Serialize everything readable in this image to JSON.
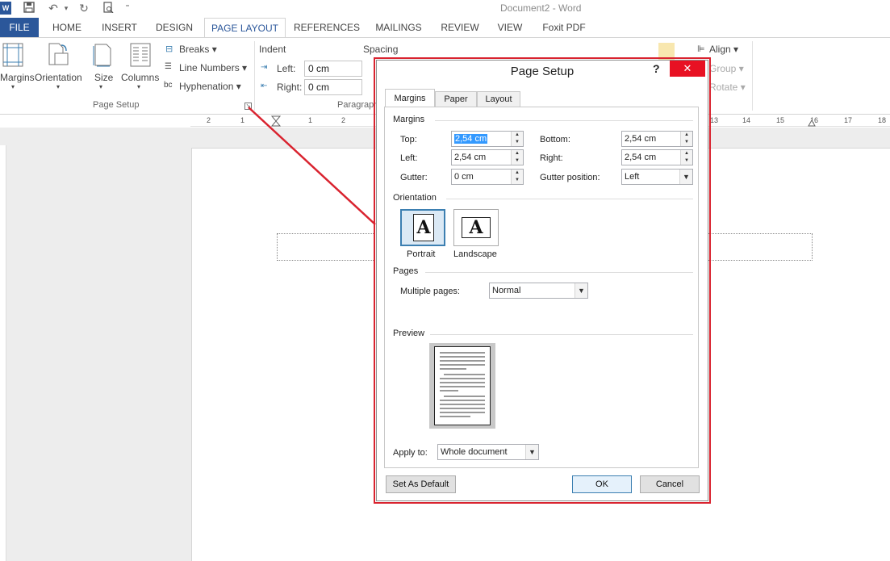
{
  "window": {
    "title": "Document2 - Word"
  },
  "quick_access": {
    "icons": [
      "word-logo-icon",
      "save-icon",
      "undo-icon",
      "redo-icon",
      "print-preview-icon",
      "customize-icon"
    ]
  },
  "tabs": [
    "FILE",
    "HOME",
    "INSERT",
    "DESIGN",
    "PAGE LAYOUT",
    "REFERENCES",
    "MAILINGS",
    "REVIEW",
    "VIEW",
    "Foxit PDF"
  ],
  "ribbon": {
    "margins": "Margins",
    "orientation": "Orientation",
    "size": "Size",
    "columns": "Columns",
    "breaks": "Breaks",
    "line_numbers": "Line Numbers",
    "hyphenation": "Hyphenation",
    "page_setup_group": "Page Setup",
    "indent": "Indent",
    "indent_left_label": "Left:",
    "indent_left_value": "0 cm",
    "indent_right_label": "Right:",
    "indent_right_value": "0 cm",
    "spacing": "Spacing",
    "paragraph_group": "Paragraph",
    "align": "Align",
    "group": "Group",
    "rotate": "Rotate"
  },
  "ruler": {
    "left_ticks": [
      "2",
      "1"
    ],
    "ticks": [
      "1",
      "2"
    ],
    "right_ticks": [
      "13",
      "14",
      "15",
      "16",
      "17",
      "18"
    ]
  },
  "dialog": {
    "title": "Page Setup",
    "help": "?",
    "close": "✕",
    "tabs": [
      "Margins",
      "Paper",
      "Layout"
    ],
    "margins_section": "Margins",
    "top_label": "Top:",
    "top_value": "2,54 cm",
    "bottom_label": "Bottom:",
    "bottom_value": "2,54 cm",
    "left_label": "Left:",
    "left_value": "2,54 cm",
    "right_label": "Right:",
    "right_value": "2,54 cm",
    "gutter_label": "Gutter:",
    "gutter_value": "0 cm",
    "gutter_position_label": "Gutter position:",
    "gutter_position_value": "Left",
    "orientation_section": "Orientation",
    "portrait": "Portrait",
    "landscape": "Landscape",
    "orientation_glyph": "A",
    "pages_section": "Pages",
    "multiple_pages_label": "Multiple pages:",
    "multiple_pages_value": "Normal",
    "preview_section": "Preview",
    "apply_to_label": "Apply to:",
    "apply_to_value": "Whole document",
    "set_default": "Set As Default",
    "ok": "OK",
    "cancel": "Cancel"
  },
  "colors": {
    "accent": "#2b579a",
    "annotation": "#d9232f",
    "close": "#e81123",
    "selection": "#3399ff"
  }
}
